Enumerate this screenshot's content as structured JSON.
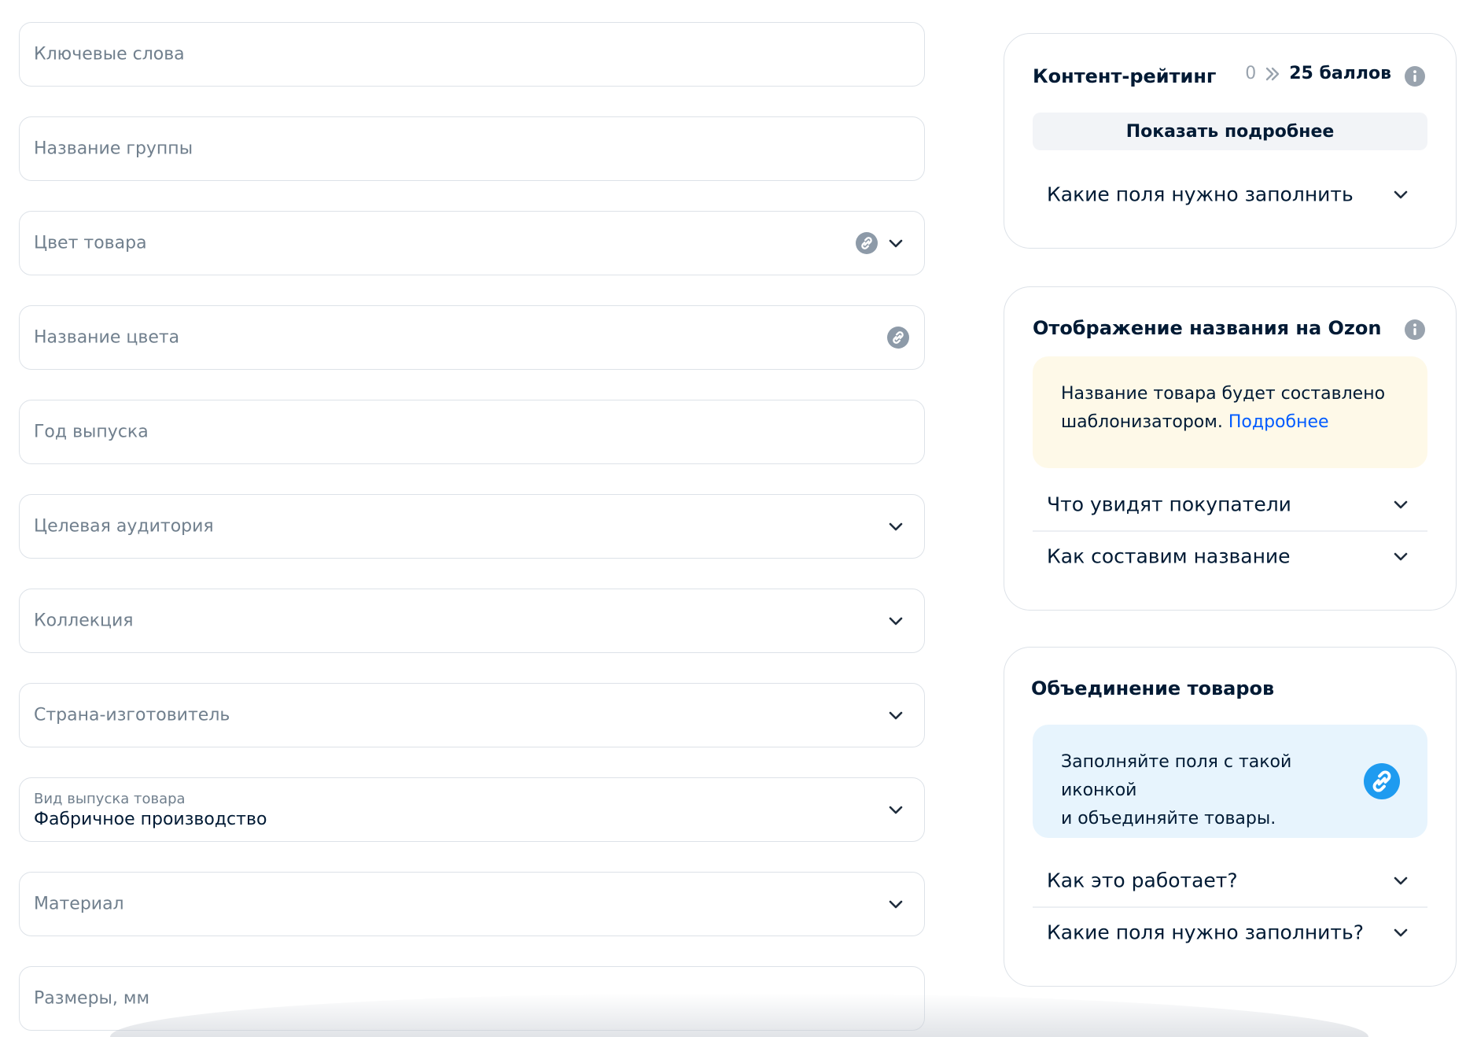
{
  "form": {
    "fields": [
      {
        "placeholder": "Ключевые слова"
      },
      {
        "placeholder": "Название группы"
      },
      {
        "placeholder": "Цвет товара"
      },
      {
        "placeholder": "Название цвета"
      },
      {
        "placeholder": "Год выпуска"
      },
      {
        "placeholder": "Целевая аудитория"
      },
      {
        "placeholder": "Коллекция"
      },
      {
        "placeholder": "Страна-изготовитель"
      },
      {
        "label": "Вид выпуска товара",
        "value": "Фабричное производство"
      },
      {
        "placeholder": "Материал"
      },
      {
        "placeholder": "Размеры, мм"
      }
    ]
  },
  "content_rating": {
    "title": "Контент-рейтинг",
    "from": "0",
    "to": "25 баллов",
    "show_more_label": "Показать подробнее",
    "accordion": [
      "Какие поля нужно заполнить"
    ]
  },
  "name_display": {
    "title": "Отображение названия на Ozon",
    "note_line1": "Название товара будет составлено",
    "note_line2": "шаблонизатором.",
    "note_link": "Подробнее",
    "accordion": [
      "Что увидят покупатели",
      "Как составим название"
    ]
  },
  "merge": {
    "title": "Объединение товаров",
    "note_line1": "Заполняйте поля с такой иконкой",
    "note_line2": "и объединяйте товары.",
    "accordion": [
      "Как это работает?",
      "Какие поля нужно заполнить?"
    ]
  },
  "colors": {
    "text": "#001a34",
    "muted": "#707f8d",
    "border": "#dde2e8",
    "link": "#005bff",
    "note_yellow": "#fef9e8",
    "note_blue": "#e7f4fd",
    "merge_icon": "#1e9bf0"
  }
}
